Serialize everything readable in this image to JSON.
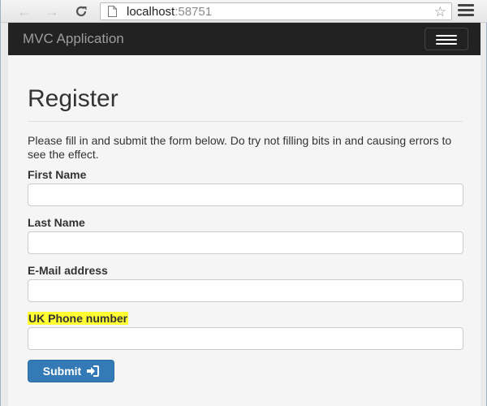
{
  "browser": {
    "url_host": "localhost",
    "url_port": ":58751",
    "icons": {
      "back": "arrow-left-icon",
      "forward": "arrow-right-icon",
      "reload": "reload-icon",
      "star": "star-icon",
      "menu": "hamburger-menu-icon"
    }
  },
  "navbar": {
    "brand": "MVC Application",
    "toggle_icon": "hamburger-menu-icon"
  },
  "page": {
    "title": "Register",
    "intro": "Please fill in and submit the form below. Do try not filling bits in and causing errors to see the effect."
  },
  "form": {
    "fields": [
      {
        "label": "First Name",
        "value": "",
        "highlighted": false
      },
      {
        "label": "Last Name",
        "value": "",
        "highlighted": false
      },
      {
        "label": "E-Mail address",
        "value": "",
        "highlighted": false
      },
      {
        "label": "UK Phone number",
        "value": "",
        "highlighted": true
      }
    ],
    "submit_label": "Submit",
    "submit_icon": "sign-in-icon"
  },
  "colors": {
    "navbar_bg": "#222222",
    "brand_text": "#9d9d9d",
    "primary_button": "#337ab7",
    "highlight": "#ffff33"
  }
}
